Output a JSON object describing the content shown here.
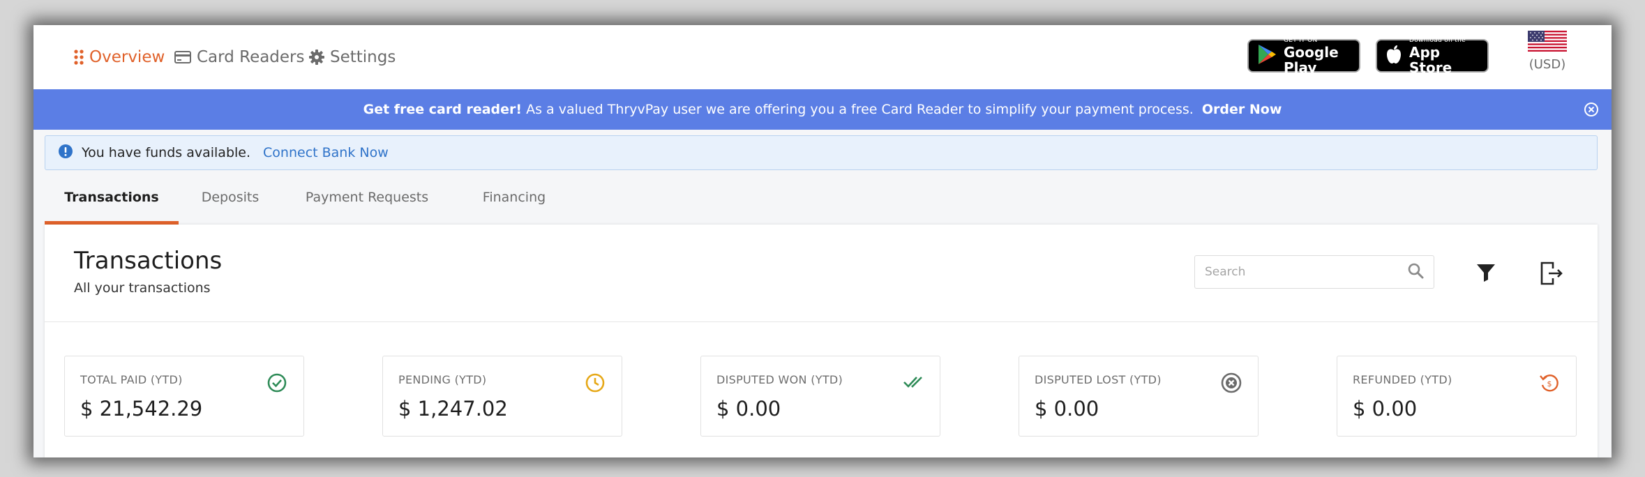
{
  "nav": {
    "items": [
      {
        "label": "Overview",
        "icon": "dots-grid-icon",
        "active": true
      },
      {
        "label": "Card Readers",
        "icon": "credit-card-icon",
        "active": false
      },
      {
        "label": "Settings",
        "icon": "gear-icon",
        "active": false
      }
    ],
    "google_play": {
      "small": "GET IT ON",
      "big": "Google Play"
    },
    "app_store": {
      "small": "Download on the",
      "big": "App Store"
    },
    "currency": {
      "code": "(USD)",
      "icon": "us-flag-icon"
    }
  },
  "promo": {
    "lead": "Get free card reader!",
    "text": "As a valued ThryvPay user we are offering you a free Card Reader to simplify your payment process.",
    "action": "Order Now"
  },
  "alert": {
    "text": "You have funds available.",
    "action": "Connect Bank Now"
  },
  "tabs": [
    {
      "label": "Transactions",
      "active": true
    },
    {
      "label": "Deposits",
      "active": false
    },
    {
      "label": "Payment Requests",
      "active": false
    },
    {
      "label": "Financing",
      "active": false
    }
  ],
  "card": {
    "title": "Transactions",
    "subtitle": "All your transactions",
    "search_placeholder": "Search"
  },
  "stats": [
    {
      "label": "TOTAL PAID (YTD)",
      "value": "$ 21,542.29",
      "icon": "check-circle-icon",
      "color": "#2e8b57"
    },
    {
      "label": "PENDING (YTD)",
      "value": "$ 1,247.02",
      "icon": "clock-icon",
      "color": "#e6a817"
    },
    {
      "label": "DISPUTED WON (YTD)",
      "value": "$ 0.00",
      "icon": "double-check-icon",
      "color": "#2e8b57"
    },
    {
      "label": "DISPUTED LOST (YTD)",
      "value": "$ 0.00",
      "icon": "x-circle-icon",
      "color": "#6b6b6b"
    },
    {
      "label": "REFUNDED (YTD)",
      "value": "$ 0.00",
      "icon": "refund-history-icon",
      "color": "#e0612a"
    }
  ],
  "colors": {
    "accent": "#e0612a",
    "banner": "#5b7ee5",
    "link": "#2f73c9"
  }
}
